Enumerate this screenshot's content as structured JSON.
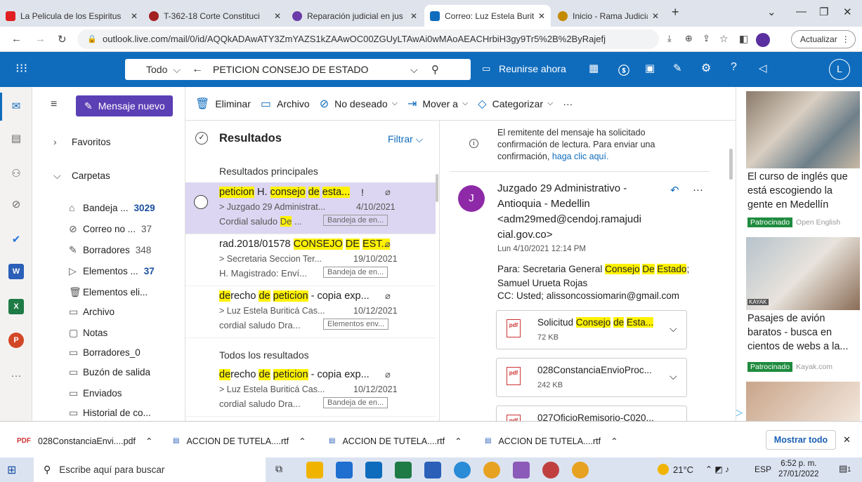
{
  "browser": {
    "tabs": [
      {
        "label": "La Pelicula de los Espiritus",
        "close": "✕",
        "color": "#e02020"
      },
      {
        "label": "T-362-18 Corte Constituci",
        "close": "✕",
        "color": "#a32020"
      },
      {
        "label": "Reparación judicial en jus",
        "close": "✕",
        "color": "#6b3aa8"
      },
      {
        "label": "Correo: Luz Estela Buriticá",
        "close": "✕",
        "color": "#0f6cbd"
      },
      {
        "label": "Inicio - Rama Judicial",
        "close": "✕",
        "color": "#c48a00"
      }
    ],
    "new_tab": "+",
    "url": "outlook.live.com/mail/0/id/AQQkADAwATY3ZmYAZS1kZAAwOC00ZGUyLTAwAi0wMAoAEACHrbiH3gy9Tr5%2B%2ByRajefj",
    "update_label": "Actualizar"
  },
  "outlook": {
    "search_scope": "Todo",
    "search_query": "PETICION CONSEJO DE ESTADO",
    "meet_now": "Reunirse ahora",
    "avatar_initial": "L"
  },
  "rail": [
    "mail-icon",
    "calendar-icon",
    "people-icon",
    "attach-icon",
    "todo-icon",
    "word-icon",
    "excel-icon",
    "powerpoint-icon",
    "more-icon"
  ],
  "folders": {
    "new_mail": "Mensaje nuevo",
    "favorites": "Favoritos",
    "folders_label": "Carpetas",
    "items": [
      {
        "label": "Bandeja ...",
        "count": "3029",
        "bold": true
      },
      {
        "label": "Correo no ...",
        "count": "37",
        "bold": false
      },
      {
        "label": "Borradores",
        "count": "348",
        "bold": false
      },
      {
        "label": "Elementos ...",
        "count": "37",
        "bold": true
      },
      {
        "label": "Elementos eli...",
        "count": "",
        "bold": false
      },
      {
        "label": "Archivo",
        "count": "",
        "bold": false
      },
      {
        "label": "Notas",
        "count": "",
        "bold": false
      },
      {
        "label": "Borradores_0",
        "count": "",
        "bold": false
      },
      {
        "label": "Buzón de salida",
        "count": "",
        "bold": false
      },
      {
        "label": "Enviados",
        "count": "",
        "bold": false
      },
      {
        "label": "Historial de co...",
        "count": "",
        "bold": false
      }
    ]
  },
  "toolbar": {
    "delete": "Eliminar",
    "archive": "Archivo",
    "junk": "No deseado",
    "move": "Mover a",
    "categorize": "Categorizar",
    "more": "···"
  },
  "list": {
    "title": "Resultados",
    "filter": "Filtrar",
    "top_results": "Resultados principales",
    "all_results": "Todos los resultados",
    "messages": [
      {
        "subject_parts": [
          "peticion",
          " H. ",
          "consejo",
          " ",
          "de",
          " ",
          "esta..."
        ],
        "sender": "> Juzgado 29 Administrat...",
        "date": "4/10/2021",
        "preview_parts": [
          "Cordial saludo ",
          "De",
          " ..."
        ],
        "folder": "Bandeja de en...",
        "importance": "!"
      },
      {
        "subject_parts": [
          "rad.2018/01578 ",
          "CONSEJO",
          " ",
          "DE",
          " ",
          "EST..."
        ],
        "sender": "> Secretaria Seccion Ter...",
        "date": "19/10/2021",
        "preview_parts": [
          "H. Magistrado: Enví..."
        ],
        "folder": "Bandeja de en..."
      },
      {
        "subject_parts": [
          "de",
          "recho ",
          "de",
          " ",
          "peticion",
          " - copia exp..."
        ],
        "sender": "> Luz Estela Buriticá Cas...",
        "date": "10/12/2021",
        "preview_parts": [
          "cordial saludo Dra..."
        ],
        "folder": "Elementos env..."
      },
      {
        "subject_parts": [
          "de",
          "recho ",
          "de",
          " ",
          "peticion",
          " - copia exp..."
        ],
        "sender": "> Luz Estela Buriticá Cas...",
        "date": "10/12/2021",
        "preview_parts": [
          "cordial saludo Dra..."
        ],
        "folder": "Bandeja de en..."
      }
    ]
  },
  "reading": {
    "read_receipt": "El remitente del mensaje ha solicitado confirmación de lectura. Para enviar una confirmación, ",
    "read_receipt_link": "haga clic aquí.",
    "sender_initial": "J",
    "sender_lines": [
      "Juzgado 29 Administrativo -",
      "Antioquia - Medellin",
      "<adm29med@cendoj.ramajudi",
      "cial.gov.co>"
    ],
    "date": "Lun 4/10/2021 12:14 PM",
    "to_prefix": "Para:  Secretaria General ",
    "to_hl": [
      "Consejo",
      "De",
      "Estado"
    ],
    "to_suffix": ";",
    "to_line2": "Samuel Urueta Rojas",
    "cc": "CC:  Usted; alissoncossiomarin@gmail.com",
    "attachments": [
      {
        "name_parts": [
          "Solicitud ",
          "Consejo",
          " ",
          "de",
          " ",
          "Esta..."
        ],
        "size": "72 KB"
      },
      {
        "name_parts": [
          "028ConstanciaEnvioProc..."
        ],
        "size": "242 KB"
      },
      {
        "name_parts": [
          "027OficioRemisorio-C020..."
        ],
        "size": ""
      }
    ]
  },
  "ads": [
    {
      "text": "El curso de inglés que está escogiendo la gente en Medellín",
      "sponsored": "Patrocinado",
      "brand": "Open English"
    },
    {
      "text": "Pasajes de avión baratos - busca en cientos de webs a la...",
      "sponsored": "Patrocinado",
      "brand": "Kayak.com",
      "image_text": "KAYAK"
    }
  ],
  "downloads": {
    "items": [
      "028ConstanciaEnvi....pdf",
      "ACCION DE TUTELA....rtf",
      "ACCION DE TUTELA....rtf",
      "ACCION DE TUTELA....rtf"
    ],
    "show_all": "Mostrar todo"
  },
  "taskbar": {
    "search_placeholder": "Escribe aquí para buscar",
    "weather": "21°C",
    "lang": "ESP",
    "time": "6:52 p. m.",
    "date": "27/01/2022",
    "notif_count": "1"
  }
}
